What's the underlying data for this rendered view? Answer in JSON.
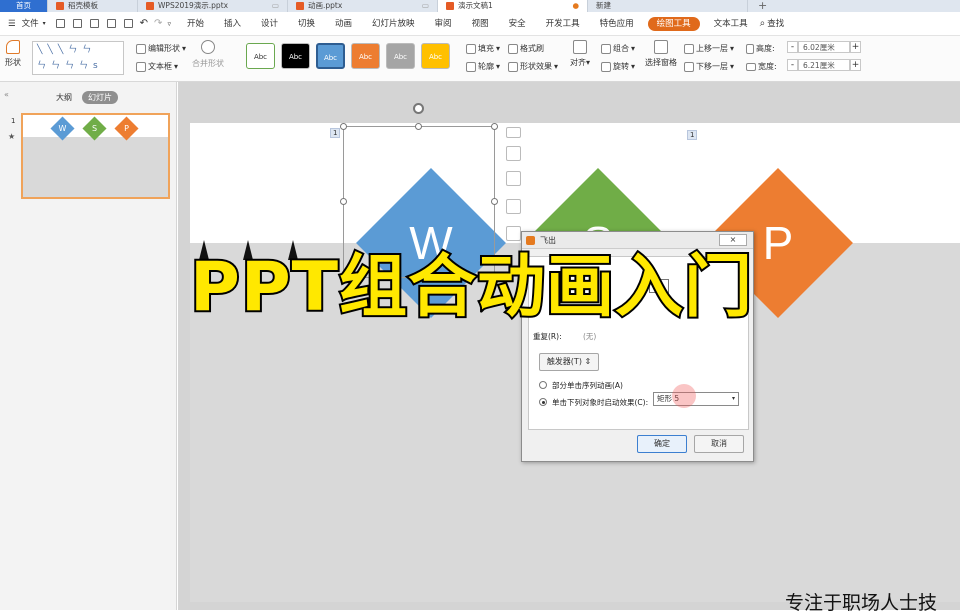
{
  "tabs": [
    {
      "label": "首页"
    },
    {
      "label": "稻壳模板"
    },
    {
      "label": "WPS2019演示.pptx"
    },
    {
      "label": "动画.pptx"
    },
    {
      "label": "演示文稿1"
    },
    {
      "label": "新建"
    }
  ],
  "menu": {
    "file": "文件",
    "items": [
      "开始",
      "插入",
      "设计",
      "切换",
      "动画",
      "幻灯片放映",
      "审阅",
      "视图",
      "安全",
      "开发工具",
      "特色应用",
      "绘图工具",
      "文本工具"
    ],
    "search": "查找"
  },
  "ribbon": {
    "shape": "形状",
    "edit_shape": "编辑形状",
    "textbox": "文本框",
    "merge_shape": "合并形状",
    "style_label": "Abc",
    "fill": "填充",
    "outline": "轮廓",
    "format_painter": "格式刷",
    "shape_effect": "形状效果",
    "align": "对齐",
    "group": "组合",
    "rotate": "旋转",
    "selection_pane": "选择窗格",
    "bring_forward": "上移一层",
    "send_backward": "下移一层",
    "height_label": "高度:",
    "height_value": "6.02厘米",
    "width_label": "宽度:",
    "width_value": "6.21厘米",
    "minus": "-",
    "plus": "+"
  },
  "colors": {
    "blue": "#5b9bd5",
    "green": "#70ad47",
    "orange": "#ed7d31",
    "gray": "#a5a5a5",
    "yellow": "#ffc000",
    "overlay": "#ffe800"
  },
  "sidebar": {
    "outline_tab": "大纲",
    "slides_tab": "幻灯片",
    "slide_number": "1",
    "star": "★"
  },
  "slide": {
    "letters": [
      "W",
      "S",
      "P"
    ],
    "tag1": "1",
    "tag2": "1"
  },
  "dialog": {
    "title": "飞出",
    "close": "×",
    "repeat_label": "重复(R):",
    "repeat_value": "(无)",
    "trigger_button": "触发器(T) ⇕",
    "option1": "部分单击序列动画(A)",
    "option2": "单击下列对象时启动效果(C):",
    "select_value": "矩形 5",
    "ok": "确定",
    "cancel": "取消"
  },
  "overlay_title": "PPT组合动画入门",
  "bottom_text": "专注于职场人士技"
}
